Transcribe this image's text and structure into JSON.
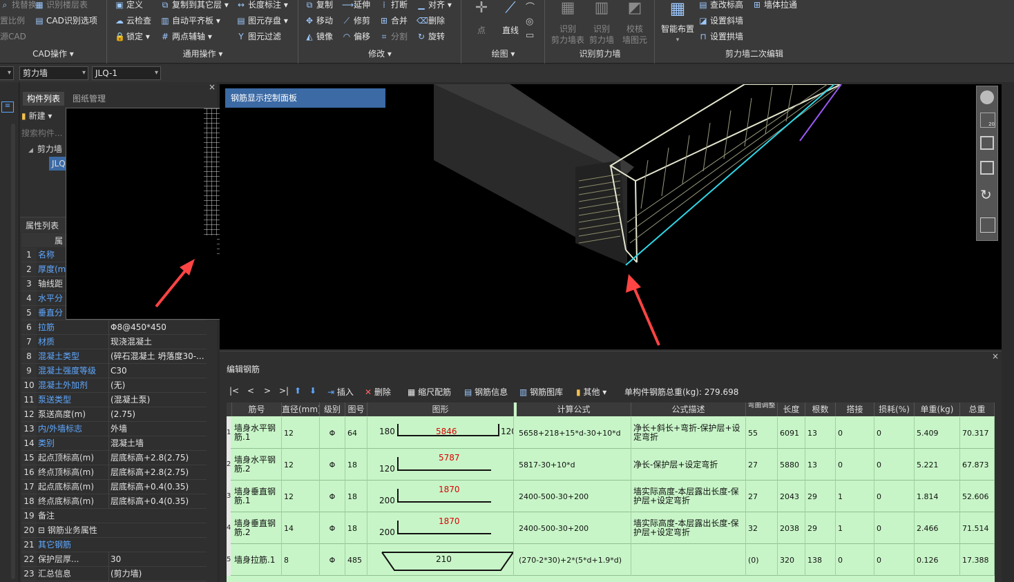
{
  "ribbon": {
    "cad_group": {
      "items": [
        "找替换",
        "识别楼层表",
        "置比例",
        "CAD识别选项",
        "源CAD"
      ],
      "label": "CAD操作 ▾"
    },
    "common_group": {
      "items": [
        "定义",
        "复制到其它层 ▾",
        "长度标注 ▾",
        "云检查",
        "自动平齐板 ▾",
        "图元存盘 ▾",
        "锁定 ▾",
        "两点辅轴 ▾",
        "图元过滤"
      ],
      "label": "通用操作 ▾"
    },
    "modify_group": {
      "items": [
        "复制",
        "延伸",
        "打断",
        "对齐 ▾",
        "移动",
        "修剪",
        "合并",
        "删除",
        "镜像",
        "偏移",
        "分割",
        "旋转"
      ],
      "label": "修改 ▾"
    },
    "draw_group": {
      "point": "点",
      "line": "直线",
      "label": "绘图 ▾"
    },
    "recognize_group": {
      "b1": "识别\n剪力墙表",
      "b2": "识别\n剪力墙",
      "b3": "校核\n墙图元",
      "label": "识别剪力墙"
    },
    "edit_group": {
      "smart": "智能布置",
      "items": [
        "查改标高",
        "墙体拉通",
        "设置斜墙",
        "设置拱墙"
      ],
      "label": "剪力墙二次编辑"
    }
  },
  "selectors": {
    "type": "剪力墙",
    "name": "JLQ-1"
  },
  "left_panel": {
    "tabs": [
      "构件列表",
      "图纸管理"
    ],
    "new_button": "新建 ▾",
    "search_placeholder": "搜索构件...",
    "tree_root": "剪力墙",
    "tree_child": "JLQ",
    "props_title": "属性列表",
    "props_header": "属",
    "rows": [
      {
        "n": "1",
        "name": "名称",
        "val": "",
        "blue": true
      },
      {
        "n": "2",
        "name": "厚度(m",
        "val": "",
        "blue": true
      },
      {
        "n": "3",
        "name": "轴线距",
        "val": "",
        "blue": false
      },
      {
        "n": "4",
        "name": "水平分",
        "val": "",
        "blue": true
      },
      {
        "n": "5",
        "name": "垂直分",
        "val": "",
        "blue": true
      },
      {
        "n": "6",
        "name": "拉筋",
        "val": "Φ8@450*450",
        "blue": true
      },
      {
        "n": "7",
        "name": "材质",
        "val": "现浇混凝土",
        "blue": true
      },
      {
        "n": "8",
        "name": "混凝土类型",
        "val": "(碎石混凝土 坍落度30-...",
        "blue": true
      },
      {
        "n": "9",
        "name": "混凝土强度等级",
        "val": "C30",
        "blue": true
      },
      {
        "n": "10",
        "name": "混凝土外加剂",
        "val": "(无)",
        "blue": true
      },
      {
        "n": "11",
        "name": "泵送类型",
        "val": "(混凝土泵)",
        "blue": true
      },
      {
        "n": "12",
        "name": "泵送高度(m)",
        "val": "(2.75)",
        "blue": false
      },
      {
        "n": "13",
        "name": "内/外墙标志",
        "val": "外墙",
        "blue": true
      },
      {
        "n": "14",
        "name": "类别",
        "val": "混凝土墙",
        "blue": true
      },
      {
        "n": "15",
        "name": "起点顶标高(m)",
        "val": "层底标高+2.8(2.75)",
        "blue": false
      },
      {
        "n": "16",
        "name": "终点顶标高(m)",
        "val": "层底标高+2.8(2.75)",
        "blue": false
      },
      {
        "n": "17",
        "name": "起点底标高(m)",
        "val": "层底标高+0.4(0.35)",
        "blue": false
      },
      {
        "n": "18",
        "name": "终点底标高(m)",
        "val": "层底标高+0.4(0.35)",
        "blue": false
      },
      {
        "n": "19",
        "name": "备注",
        "val": "",
        "blue": false
      },
      {
        "n": "20",
        "name": "⊟ 钢筋业务属性",
        "val": "",
        "blue": false
      },
      {
        "n": "21",
        "name": "其它钢筋",
        "val": "",
        "blue": true
      },
      {
        "n": "22",
        "name": "保护层厚...",
        "val": "30",
        "blue": false
      },
      {
        "n": "23",
        "name": "汇总信息",
        "val": "(剪力墙)",
        "blue": false
      }
    ]
  },
  "viewport": {
    "rebar_panel_title": "钢筋显示控制面板",
    "scale_badge": "20"
  },
  "edit_rebar": {
    "title": "编辑钢筋",
    "nav": [
      "|<",
      "<",
      ">",
      ">|"
    ],
    "insert": "插入",
    "delete": "删除",
    "scale": "缩尺配筋",
    "info": "钢筋信息",
    "library": "钢筋图库",
    "other": "其他 ▾",
    "total": "单构件钢筋总重(kg): 279.698",
    "columns": [
      "筋号",
      "直径(mm)",
      "级别",
      "图号",
      "图形",
      "计算公式",
      "公式描述",
      "弯曲调整",
      "长度",
      "根数",
      "搭接",
      "损耗(%)",
      "单重(kg)",
      "总重"
    ],
    "rows": [
      {
        "idx": "1",
        "name": "墙身水平钢筋.1",
        "dia": "12",
        "grade": "Φ",
        "fig": "64",
        "l": "180",
        "mid": "5846",
        "r": "120",
        "formula": "5658+218+15*d-30+10*d",
        "desc": "净长+斜长+弯折-保护层+设定弯折",
        "bend": "55",
        "len": "6091",
        "cnt": "13",
        "lap": "0",
        "loss": "0",
        "unit": "5.409",
        "total": "70.317"
      },
      {
        "idx": "2",
        "name": "墙身水平钢筋.2",
        "dia": "12",
        "grade": "Φ",
        "fig": "18",
        "l": "120",
        "mid": "5787",
        "r": "",
        "formula": "5817-30+10*d",
        "desc": "净长-保护层+设定弯折",
        "bend": "27",
        "len": "5880",
        "cnt": "13",
        "lap": "0",
        "loss": "0",
        "unit": "5.221",
        "total": "67.873"
      },
      {
        "idx": "3",
        "name": "墙身垂直钢筋.1",
        "dia": "12",
        "grade": "Φ",
        "fig": "18",
        "l": "200",
        "mid": "1870",
        "r": "",
        "formula": "2400-500-30+200",
        "desc": "墙实际高度-本层露出长度-保护层+设定弯折",
        "bend": "27",
        "len": "2043",
        "cnt": "29",
        "lap": "1",
        "loss": "0",
        "unit": "1.814",
        "total": "52.606"
      },
      {
        "idx": "4",
        "name": "墙身垂直钢筋.2",
        "dia": "14",
        "grade": "Φ",
        "fig": "18",
        "l": "200",
        "mid": "1870",
        "r": "",
        "formula": "2400-500-30+200",
        "desc": "墙实际高度-本层露出长度-保护层+设定弯折",
        "bend": "32",
        "len": "2038",
        "cnt": "29",
        "lap": "1",
        "loss": "0",
        "unit": "2.466",
        "total": "71.514"
      },
      {
        "idx": "5",
        "name": "墙身拉筋.1",
        "dia": "8",
        "grade": "Φ",
        "fig": "485",
        "l": "",
        "mid": "210",
        "r": "",
        "formula": "(270-2*30)+2*(5*d+1.9*d)",
        "desc": "",
        "bend": "(0)",
        "len": "320",
        "cnt": "138",
        "lap": "0",
        "loss": "0",
        "unit": "0.126",
        "total": "17.388"
      }
    ]
  },
  "colors": {
    "accent": "#3b6aa5",
    "grid_row": "#c8f5c8",
    "link": "#5fa8ff",
    "arrow": "#ff4444"
  }
}
